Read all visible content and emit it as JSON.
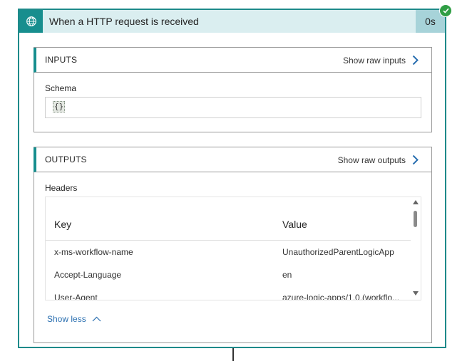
{
  "trigger": {
    "title": "When a HTTP request is received",
    "duration": "0s",
    "status": "succeeded",
    "icon": "globe-icon",
    "accent_color": "#178e8e",
    "status_color": "#2f9e44"
  },
  "inputs": {
    "title": "INPUTS",
    "show_raw_label": "Show raw inputs",
    "schema_label": "Schema",
    "schema_value": "{}"
  },
  "outputs": {
    "title": "OUTPUTS",
    "show_raw_label": "Show raw outputs",
    "headers_label": "Headers",
    "columns": [
      "Key",
      "Value"
    ],
    "rows": [
      {
        "key": "x-ms-workflow-name",
        "value": "UnauthorizedParentLogicApp"
      },
      {
        "key": "Accept-Language",
        "value": "en"
      },
      {
        "key": "User-Agent",
        "value": "azure-logic-apps/1.0,(workflo..."
      }
    ],
    "show_less_label": "Show less"
  }
}
